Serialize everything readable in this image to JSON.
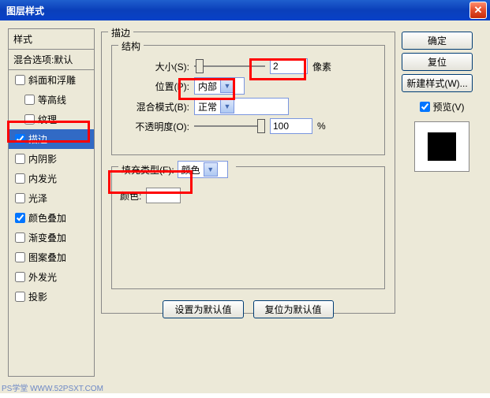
{
  "window": {
    "title": "图层样式"
  },
  "styles_panel": {
    "header": "样式",
    "blend_defaults": "混合选项:默认",
    "items": [
      {
        "label": "斜面和浮雕",
        "checked": false,
        "indent": false
      },
      {
        "label": "等高线",
        "checked": false,
        "indent": true
      },
      {
        "label": "纹理",
        "checked": false,
        "indent": true
      },
      {
        "label": "描边",
        "checked": true,
        "indent": false,
        "selected": true
      },
      {
        "label": "内阴影",
        "checked": false,
        "indent": false
      },
      {
        "label": "内发光",
        "checked": false,
        "indent": false
      },
      {
        "label": "光泽",
        "checked": false,
        "indent": false
      },
      {
        "label": "颜色叠加",
        "checked": true,
        "indent": false
      },
      {
        "label": "渐变叠加",
        "checked": false,
        "indent": false
      },
      {
        "label": "图案叠加",
        "checked": false,
        "indent": false
      },
      {
        "label": "外发光",
        "checked": false,
        "indent": false
      },
      {
        "label": "投影",
        "checked": false,
        "indent": false
      }
    ]
  },
  "center": {
    "group_title": "描边",
    "structure_title": "结构",
    "size_label": "大小(S):",
    "size_value": "2",
    "size_unit": "像素",
    "position_label": "位置(P):",
    "position_value": "内部",
    "blendmode_label": "混合模式(B):",
    "blendmode_value": "正常",
    "opacity_label": "不透明度(O):",
    "opacity_value": "100",
    "opacity_unit": "%",
    "filltype_label": "填充类型(F):",
    "filltype_value": "颜色",
    "color_label": "颜色:",
    "btn_set_default": "设置为默认值",
    "btn_reset_default": "复位为默认值"
  },
  "right": {
    "ok": "确定",
    "reset": "复位",
    "new_style": "新建样式(W)...",
    "preview_label": "预览(V)"
  },
  "watermark": "PS学堂  WWW.52PSXT.COM"
}
